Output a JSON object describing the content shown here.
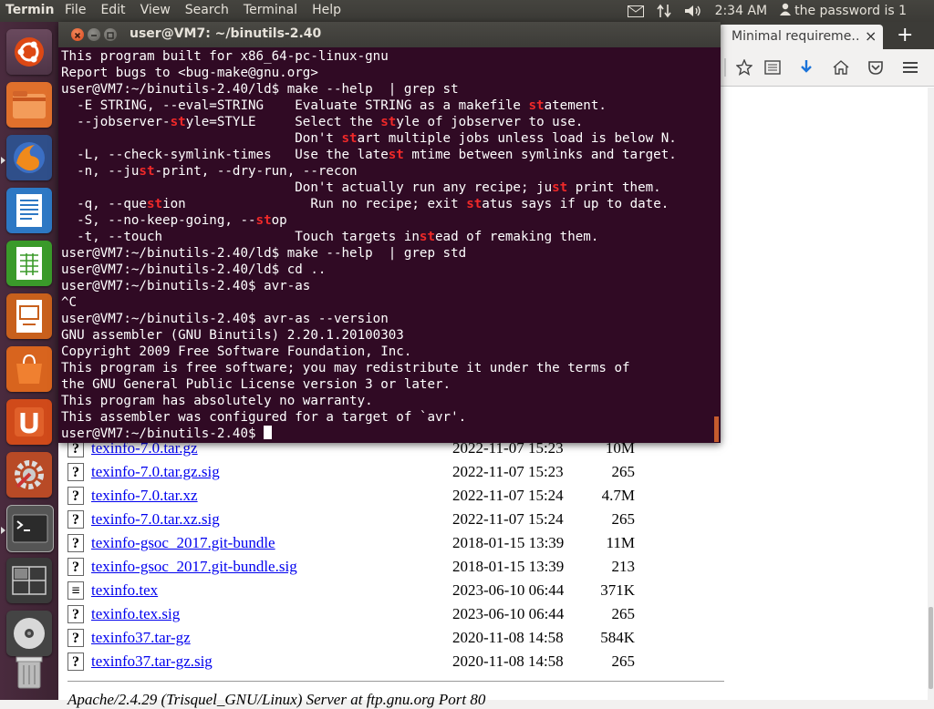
{
  "top_panel": {
    "app_title": "Termin",
    "menus": [
      "File",
      "Edit",
      "View",
      "Search",
      "Terminal",
      "Help"
    ],
    "time": "2:34 AM",
    "user": "the password is 1"
  },
  "terminal": {
    "title": "user@VM7: ~/binutils-2.40",
    "lines": [
      [
        {
          "t": "This program built for x86_64-pc-linux-gnu"
        }
      ],
      [
        {
          "t": "Report bugs to <bug-make@gnu.org>"
        }
      ],
      [
        {
          "t": "user@VM7:~/binutils-2.40/ld$ make --help  | grep st"
        }
      ],
      [
        {
          "t": "  -E STRING, --eval=STRING    Evaluate STRING as a makefile "
        },
        {
          "t": "st",
          "h": 1
        },
        {
          "t": "atement."
        }
      ],
      [
        {
          "t": "  --jobserver-"
        },
        {
          "t": "st",
          "h": 1
        },
        {
          "t": "yle=STYLE     Select the "
        },
        {
          "t": "st",
          "h": 1
        },
        {
          "t": "yle of jobserver to use."
        }
      ],
      [
        {
          "t": "                              Don't "
        },
        {
          "t": "st",
          "h": 1
        },
        {
          "t": "art multiple jobs unless load is below N."
        }
      ],
      [
        {
          "t": "  -L, --check-symlink-times   Use the late"
        },
        {
          "t": "st",
          "h": 1
        },
        {
          "t": " mtime between symlinks and target."
        }
      ],
      [
        {
          "t": "  -n, --ju"
        },
        {
          "t": "st",
          "h": 1
        },
        {
          "t": "-print, --dry-run, --recon"
        }
      ],
      [
        {
          "t": "                              Don't actually run any recipe; ju"
        },
        {
          "t": "st",
          "h": 1
        },
        {
          "t": " print them."
        }
      ],
      [
        {
          "t": "  -q, --que"
        },
        {
          "t": "st",
          "h": 1
        },
        {
          "t": "ion                Run no recipe; exit "
        },
        {
          "t": "st",
          "h": 1
        },
        {
          "t": "atus says if up to date."
        }
      ],
      [
        {
          "t": "  -S, --no-keep-going, --"
        },
        {
          "t": "st",
          "h": 1
        },
        {
          "t": "op"
        }
      ],
      [
        {
          "t": "  -t, --touch                 Touch targets in"
        },
        {
          "t": "st",
          "h": 1
        },
        {
          "t": "ead of remaking them."
        }
      ],
      [
        {
          "t": "user@VM7:~/binutils-2.40/ld$ make --help  | grep std"
        }
      ],
      [
        {
          "t": "user@VM7:~/binutils-2.40/ld$ cd .."
        }
      ],
      [
        {
          "t": "user@VM7:~/binutils-2.40$ avr-as"
        }
      ],
      [
        {
          "t": "^C"
        }
      ],
      [
        {
          "t": "user@VM7:~/binutils-2.40$ avr-as --version"
        }
      ],
      [
        {
          "t": "GNU assembler (GNU Binutils) 2.20.1.20100303"
        }
      ],
      [
        {
          "t": "Copyright 2009 Free Software Foundation, Inc."
        }
      ],
      [
        {
          "t": "This program is free software; you may redistribute it under the terms of"
        }
      ],
      [
        {
          "t": "the GNU General Public License version 3 or later."
        }
      ],
      [
        {
          "t": "This program has absolutely no warranty."
        }
      ],
      [
        {
          "t": "This assembler was configured for a target of `avr'."
        }
      ],
      [
        {
          "t": "user@VM7:~/binutils-2.40$ "
        }
      ]
    ]
  },
  "browser": {
    "tab_title": "Minimal requireme…",
    "tab_close": "×",
    "new_tab": "+",
    "files": [
      {
        "name": "texinfo-7.0.tar.gz",
        "date": "2022-11-07 15:23",
        "size": "10M",
        "icon": "?"
      },
      {
        "name": "texinfo-7.0.tar.gz.sig",
        "date": "2022-11-07 15:23",
        "size": "265",
        "icon": "?"
      },
      {
        "name": "texinfo-7.0.tar.xz",
        "date": "2022-11-07 15:24",
        "size": "4.7M",
        "icon": "?"
      },
      {
        "name": "texinfo-7.0.tar.xz.sig",
        "date": "2022-11-07 15:24",
        "size": "265",
        "icon": "?"
      },
      {
        "name": "texinfo-gsoc_2017.git-bundle",
        "date": "2018-01-15 13:39",
        "size": "11M",
        "icon": "?"
      },
      {
        "name": "texinfo-gsoc_2017.git-bundle.sig",
        "date": "2018-01-15 13:39",
        "size": "213",
        "icon": "?"
      },
      {
        "name": "texinfo.tex",
        "date": "2023-06-10 06:44",
        "size": "371K",
        "icon": "≡"
      },
      {
        "name": "texinfo.tex.sig",
        "date": "2023-06-10 06:44",
        "size": "265",
        "icon": "?"
      },
      {
        "name": "texinfo37.tar-gz",
        "date": "2020-11-08 14:58",
        "size": "584K",
        "icon": "?"
      },
      {
        "name": "texinfo37.tar-gz.sig",
        "date": "2020-11-08 14:58",
        "size": "265",
        "icon": "?"
      }
    ],
    "footer": "Apache/2.4.29 (Trisquel_GNU/Linux) Server at ftp.gnu.org Port 80"
  }
}
